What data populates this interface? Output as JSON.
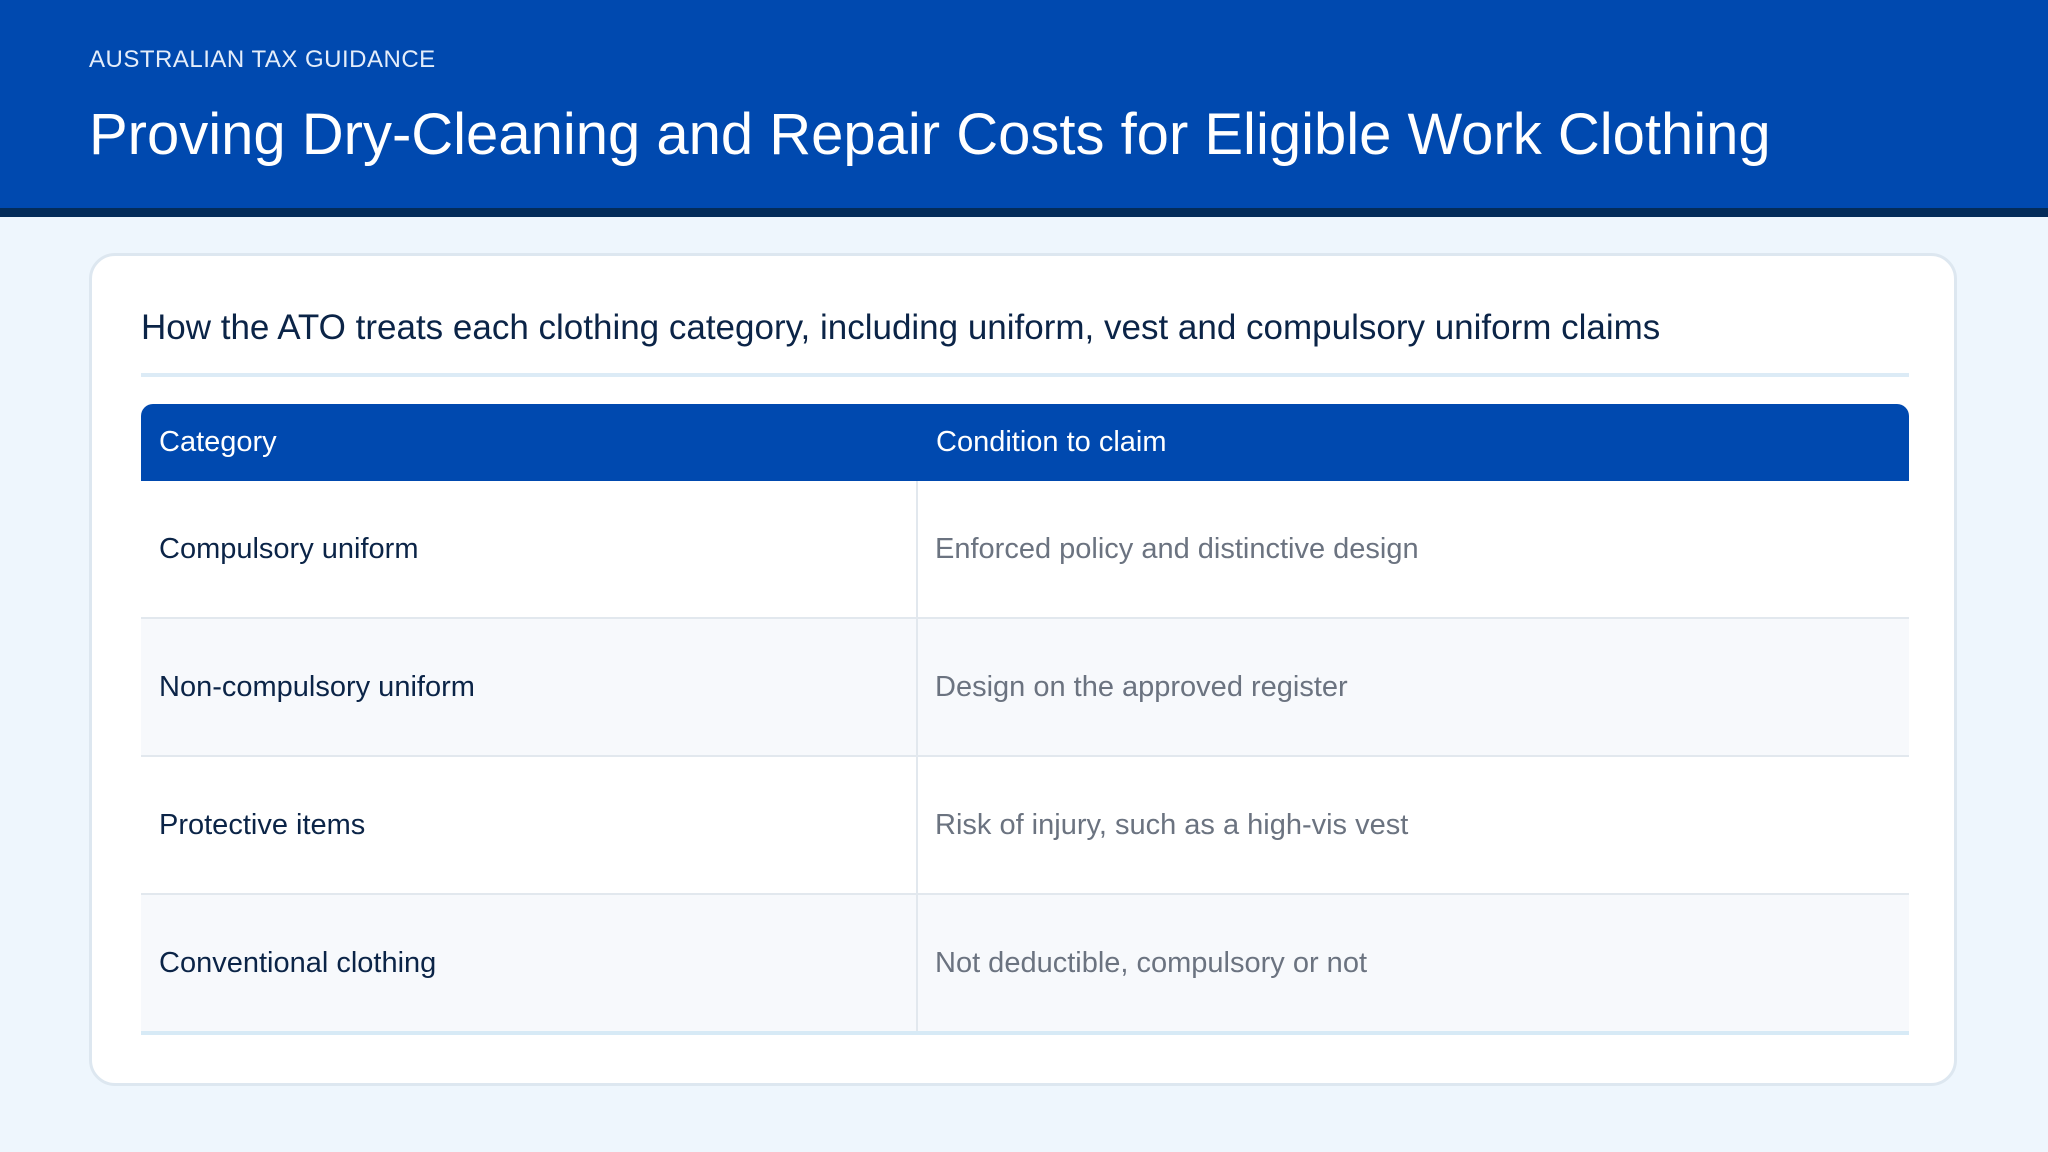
{
  "header": {
    "eyebrow": "AUSTRALIAN TAX GUIDANCE",
    "title": "Proving Dry-Cleaning and Repair Costs for Eligible Work Clothing"
  },
  "card": {
    "subtitle": "How the ATO treats each clothing category, including uniform, vest and compulsory uniform claims"
  },
  "table": {
    "headers": [
      "Category",
      "Condition to claim"
    ],
    "rows": [
      {
        "category": "Compulsory uniform",
        "condition": "Enforced policy and distinctive design"
      },
      {
        "category": "Non-compulsory uniform",
        "condition": "Design on the approved register"
      },
      {
        "category": "Protective items",
        "condition": "Risk of injury, such as a high-vis vest"
      },
      {
        "category": "Conventional clothing",
        "condition": "Not deductible, compulsory or not"
      }
    ]
  },
  "colors": {
    "brand_blue": "#0049af",
    "header_border": "#032c5a",
    "page_background": "#eef6fd",
    "heading_text": "#0b2447",
    "muted_text": "#6b7380"
  }
}
